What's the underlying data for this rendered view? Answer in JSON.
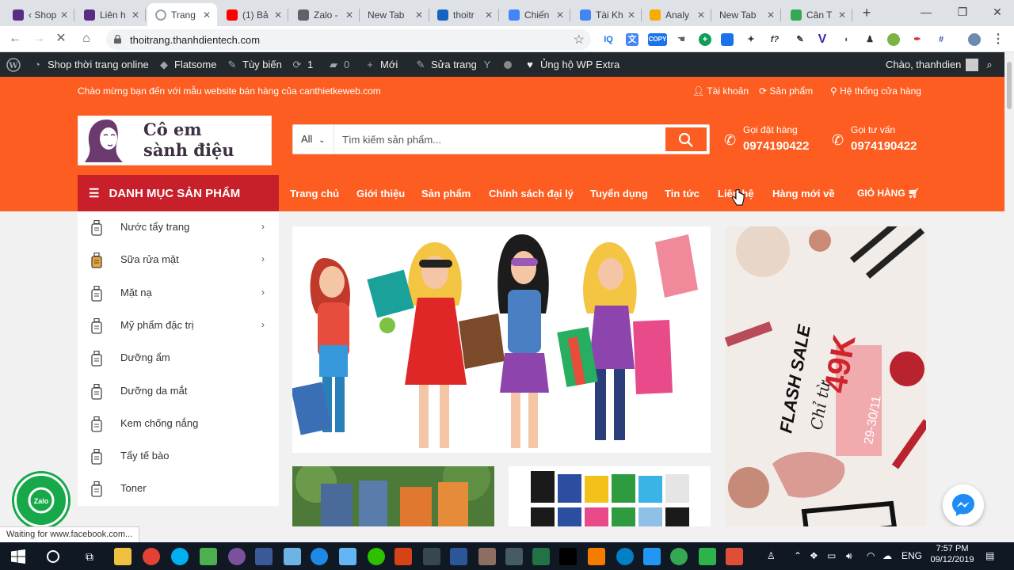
{
  "browser": {
    "tabs": [
      {
        "title": "‹ Shop",
        "color": "#5b2c83"
      },
      {
        "title": "Liên h",
        "color": "#5b2c83"
      },
      {
        "title": "Trang",
        "color": "#9aa0a6",
        "active": true
      },
      {
        "title": "(1) Bả",
        "color": "#ff0000"
      },
      {
        "title": "Zalo -",
        "color": "#5f6368"
      },
      {
        "title": "New Tab",
        "color": ""
      },
      {
        "title": "thoitr",
        "color": "#1565c0"
      },
      {
        "title": "Chiến",
        "color": "#4285f4"
      },
      {
        "title": "Tài Kh",
        "color": "#4285f4"
      },
      {
        "title": "Analy",
        "color": "#f9ab00"
      },
      {
        "title": "New Tab",
        "color": ""
      },
      {
        "title": "Cân T",
        "color": "#34a853"
      }
    ],
    "url": "thoitrang.thanhdientech.com",
    "status_text": "Waiting for www.facebook.com..."
  },
  "adminbar": {
    "site_name": "Shop thời trang online",
    "theme": "Flatsome",
    "customize": "Tùy biến",
    "updates": "1",
    "comments": "0",
    "new": "Mới",
    "edit_page": "Sửa trang",
    "support": "Ủng hộ WP Extra",
    "greeting": "Chào, thanhdien"
  },
  "topbar": {
    "welcome": "Chào mừng bạn đến với mẫu website bán hàng của canthietkeweb.com",
    "account": "Tài khoản",
    "products": "Sản phẩm",
    "stores": "Hệ thống cửa hàng"
  },
  "logo": {
    "line1": "Cô em",
    "line2": "sành điệu"
  },
  "search": {
    "category": "All",
    "placeholder": "Tìm kiếm sản phẩm..."
  },
  "hotlines": [
    {
      "label": "Gọi đặt hàng",
      "number": "0974190422"
    },
    {
      "label": "Gọi tư vấn",
      "number": "0974190422"
    }
  ],
  "catmenu_title": "DANH MỤC SẢN PHẨM",
  "mainmenu": [
    "Trang chủ",
    "Giới thiệu",
    "Sản phẩm",
    "Chính sách đại lý",
    "Tuyển dụng",
    "Tin tức",
    "Liên hệ",
    "Hàng mới về",
    "GIỎ HÀNG"
  ],
  "categories": [
    {
      "label": "Nước tẩy trang",
      "has_sub": true
    },
    {
      "label": "Sữa rửa mặt",
      "has_sub": true
    },
    {
      "label": "Mặt nạ",
      "has_sub": true
    },
    {
      "label": "Mỹ phẩm đặc trị",
      "has_sub": true
    },
    {
      "label": "Dưỡng ẩm",
      "has_sub": false
    },
    {
      "label": "Dưỡng da mắt",
      "has_sub": false
    },
    {
      "label": "Kem chống nắng",
      "has_sub": false
    },
    {
      "label": "Tẩy tế bào",
      "has_sub": false
    },
    {
      "label": "Toner",
      "has_sub": false
    }
  ],
  "flashsale": {
    "word": "FLASH SALE",
    "prefix": "Chỉ từ",
    "price": "49K",
    "dates": "29-30/11"
  },
  "taskbar": {
    "time": "7:57 PM",
    "date": "09/12/2019",
    "lang": "ENG"
  },
  "colors": {
    "accent": "#fd5d20",
    "category_red": "#c8202a",
    "adminbar": "#23282d"
  }
}
